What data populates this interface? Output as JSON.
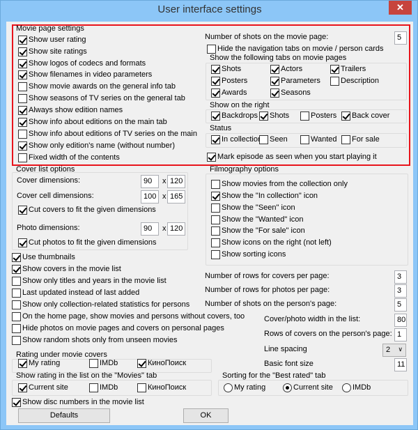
{
  "window": {
    "title": "User interface settings",
    "close_icon": "close-icon"
  },
  "movie_page": {
    "label": "Movie page settings",
    "options": [
      {
        "label": "Show user rating",
        "checked": true
      },
      {
        "label": "Show site ratings",
        "checked": true
      },
      {
        "label": "Show logos of codecs and formats",
        "checked": true
      },
      {
        "label": "Show filenames in video parameters",
        "checked": true
      },
      {
        "label": "Show movie awards on the general info tab",
        "checked": false
      },
      {
        "label": "Show seasons of TV series on the general tab",
        "checked": false
      },
      {
        "label": "Always show edition names",
        "checked": true
      },
      {
        "label": "Show info about editions on the main tab",
        "checked": true
      },
      {
        "label": "Show info about editions of TV series on the main",
        "checked": false
      },
      {
        "label": "Show only edition's name (without number)",
        "checked": true
      },
      {
        "label": "Fixed width of the contents",
        "checked": false
      }
    ],
    "shots_label": "Number of shots on the movie page:",
    "shots_value": "5",
    "hide_nav": {
      "label": "Hide the navigation tabs on movie / person cards",
      "checked": false
    },
    "tabs_group": {
      "label": "Show the following tabs on movie pages",
      "items": [
        {
          "label": "Shots",
          "checked": true
        },
        {
          "label": "Actors",
          "checked": true
        },
        {
          "label": "Trailers",
          "checked": true
        },
        {
          "label": "Posters",
          "checked": true
        },
        {
          "label": "Parameters",
          "checked": true
        },
        {
          "label": "Description",
          "checked": false
        },
        {
          "label": "Awards",
          "checked": true
        },
        {
          "label": "Seasons",
          "checked": true
        }
      ]
    },
    "right_group": {
      "label": "Show on the right",
      "items": [
        {
          "label": "Backdrops",
          "checked": true
        },
        {
          "label": "Shots",
          "checked": true
        },
        {
          "label": "Posters",
          "checked": false
        },
        {
          "label": "Back cover",
          "checked": true
        }
      ]
    },
    "status_group": {
      "label": "Status",
      "items": [
        {
          "label": "In collection",
          "checked": true
        },
        {
          "label": "Seen",
          "checked": false
        },
        {
          "label": "Wanted",
          "checked": false
        },
        {
          "label": "For sale",
          "checked": false
        }
      ]
    },
    "mark_episode": {
      "label": "Mark episode as seen when you start playing it",
      "checked": true
    }
  },
  "cover_list": {
    "label": "Cover list options",
    "cover_dim_label": "Cover dimensions:",
    "cover_w": "90",
    "cover_h": "120",
    "cell_dim_label": "Cover cell dimensions:",
    "cell_w": "100",
    "cell_h": "165",
    "cut_covers": {
      "label": "Cut covers to fit the given dimensions",
      "checked": true
    },
    "photo_dim_label": "Photo dimensions:",
    "photo_w": "90",
    "photo_h": "120",
    "cut_photos": {
      "label": "Cut photos to fit the given dimensions",
      "checked": true
    },
    "x_sep": "x"
  },
  "general": [
    {
      "label": "Use thumbnails",
      "checked": true
    },
    {
      "label": "Show covers in the movie list",
      "checked": true
    },
    {
      "label": "Show only titles and years in the movie list",
      "checked": false
    },
    {
      "label": "Last updated instead of last added",
      "checked": false
    },
    {
      "label": "Show only collection-related statistics for persons",
      "checked": false
    },
    {
      "label": "On the home page, show movies and persons without covers, too",
      "checked": false
    },
    {
      "label": "Hide photos on movie pages and covers on personal pages",
      "checked": false
    },
    {
      "label": "Show random shots only from unseen movies",
      "checked": false
    }
  ],
  "filmography": {
    "label": "Filmography options",
    "items": [
      {
        "label": "Show movies from the collection only",
        "checked": false
      },
      {
        "label": "Show the \"In collection\" icon",
        "checked": true
      },
      {
        "label": "Show the \"Seen\" icon",
        "checked": false
      },
      {
        "label": "Show the \"Wanted\" icon",
        "checked": false
      },
      {
        "label": "Show the \"For sale\" icon",
        "checked": false
      },
      {
        "label": "Show icons on the right (not left)",
        "checked": false
      },
      {
        "label": "Show sorting icons",
        "checked": false
      }
    ]
  },
  "fields": {
    "rows_covers_label": "Number of rows for covers per page:",
    "rows_covers": "3",
    "rows_photos_label": "Number of rows for photos per page:",
    "rows_photos": "3",
    "person_shots_label": "Number of shots on the person's page:",
    "person_shots": "5",
    "cover_width_label": "Cover/photo width in the list:",
    "cover_width": "80",
    "person_rows_label": "Rows of covers on the person's page:",
    "person_rows": "1",
    "line_spacing_label": "Line spacing",
    "line_spacing": "2",
    "font_size_label": "Basic font size",
    "font_size": "11"
  },
  "rating_covers": {
    "label": "Rating under movie covers",
    "items": [
      {
        "label": "My rating",
        "checked": true
      },
      {
        "label": "IMDb",
        "checked": false
      },
      {
        "label": "КиноПоиск",
        "checked": true
      }
    ]
  },
  "rating_list": {
    "label": "Show rating in the list on the \"Movies\" tab",
    "items": [
      {
        "label": "Current site",
        "checked": true
      },
      {
        "label": "IMDb",
        "checked": false
      },
      {
        "label": "КиноПоиск",
        "checked": false
      }
    ]
  },
  "sorting": {
    "label": "Sorting for the \"Best rated\" tab",
    "items": [
      {
        "label": "My rating",
        "selected": false
      },
      {
        "label": "Current site",
        "selected": true
      },
      {
        "label": "IMDb",
        "selected": false
      }
    ]
  },
  "disc_numbers": {
    "label": "Show disc numbers in the movie list",
    "checked": true
  },
  "buttons": {
    "defaults": "Defaults",
    "ok": "OK"
  }
}
